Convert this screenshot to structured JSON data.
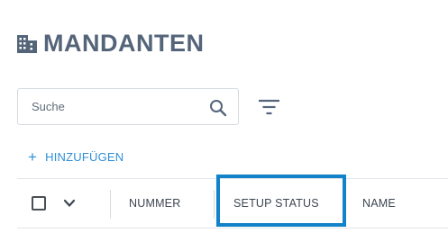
{
  "header": {
    "title": "MANDANTEN",
    "icon": "building-icon"
  },
  "search": {
    "placeholder": "Suche",
    "value": "",
    "icon": "search-icon"
  },
  "toolbar": {
    "filter_icon": "filter-icon",
    "add_label": "HINZUFÜGEN",
    "add_symbol": "+"
  },
  "table": {
    "columns": [
      {
        "label": "NUMMER"
      },
      {
        "label": "SETUP STATUS"
      },
      {
        "label": "NAME"
      }
    ],
    "select_all_checked": false,
    "highlighted_column": "SETUP STATUS"
  },
  "colors": {
    "title": "#54657a",
    "accent": "#2f8fd8",
    "highlight": "#1283c8"
  }
}
